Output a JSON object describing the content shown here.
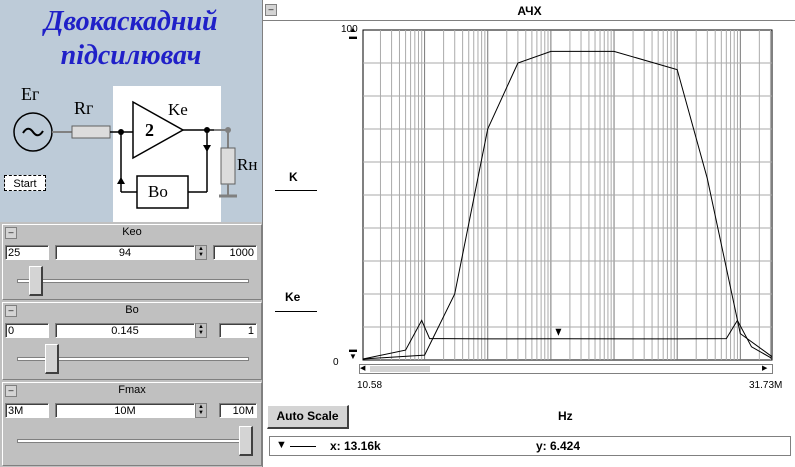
{
  "schematic": {
    "title_line1": "Двокаскадний",
    "title_line2": "підсилювач",
    "source_label": "Ег",
    "rg_label": "Rг",
    "amp_number": "2",
    "ke_label": "Kе",
    "rn_label": "Rн",
    "bo_label": "Bо",
    "start_button": "Start"
  },
  "controls": [
    {
      "name": "Keo",
      "min": "25",
      "value": "94",
      "max": "1000",
      "level_fraction": 0.07
    },
    {
      "name": "Bo",
      "min": "0",
      "value": "0.145",
      "max": "1",
      "level_fraction": 0.145
    },
    {
      "name": "Fmax",
      "min": "3M",
      "value": "10M",
      "max": "10M",
      "level_fraction": 1.0
    }
  ],
  "plot": {
    "title": "АЧХ",
    "y_top": "100",
    "y_bottom": "0",
    "x_left": "10.58",
    "x_right": "31.73M",
    "left_label_top": "K",
    "left_label_bottom": "Ke",
    "auto_scale": "Auto Scale",
    "x_unit": "Hz",
    "cursor_x": "x: 13.16k",
    "cursor_y": "y: 6.424"
  },
  "chart_data": {
    "type": "line",
    "title": "АЧХ",
    "xlabel": "Hz",
    "ylabel": "",
    "xscale": "log",
    "xlim": [
      10.58,
      31730000
    ],
    "ylim": [
      0,
      100
    ],
    "grid": true,
    "series": [
      {
        "name": "K",
        "x": [
          10.58,
          100,
          300,
          1000,
          3000,
          10000,
          100000,
          1000000,
          3000000,
          10000000,
          31730000
        ],
        "y": [
          0.3,
          1.5,
          20,
          70,
          90,
          93.5,
          93.5,
          88,
          55,
          8,
          1
        ]
      },
      {
        "name": "Ke",
        "x": [
          10.58,
          50,
          90,
          120,
          200,
          1000,
          13160,
          1000000,
          6000000,
          9000000,
          15000000,
          31730000
        ],
        "y": [
          0.3,
          3,
          12,
          6.5,
          6.5,
          6.4,
          6.424,
          6.4,
          6.5,
          12,
          4,
          0.5
        ]
      }
    ]
  }
}
